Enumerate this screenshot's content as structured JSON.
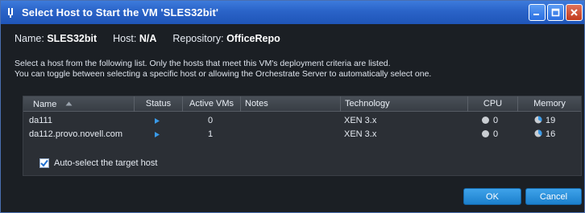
{
  "window": {
    "title": "Select Host to Start the VM 'SLES32bit'",
    "controls": [
      "minimize-icon",
      "maximize-icon",
      "close-icon"
    ]
  },
  "header": {
    "name_label": "Name:",
    "name_value": "SLES32bit",
    "host_label": "Host:",
    "host_value": "N/A",
    "repo_label": "Repository:",
    "repo_value": "OfficeRepo"
  },
  "instructions": {
    "line1": "Select a host from the following list. Only the hosts that meet this VM's deployment criteria are listed.",
    "line2": "You can toggle between selecting a specific host or allowing the Orchestrate Server to automatically select one."
  },
  "table": {
    "columns": [
      "Name",
      "Status",
      "Active VMs",
      "Notes",
      "Technology",
      "CPU",
      "Memory"
    ],
    "sort_icon": "sort-ascending-icon",
    "rows": [
      {
        "name": "da111",
        "status_icon": "status-flag-icon",
        "active_vms": "0",
        "notes": "",
        "technology": "XEN 3.x",
        "cpu": "0",
        "memory": "19"
      },
      {
        "name": "da112.provo.novell.com",
        "status_icon": "status-flag-icon",
        "active_vms": "1",
        "notes": "",
        "technology": "XEN 3.x",
        "cpu": "0",
        "memory": "16"
      }
    ]
  },
  "auto_select": {
    "label": "Auto-select the target host",
    "checked": true
  },
  "buttons": {
    "ok": "OK",
    "cancel": "Cancel"
  },
  "colors": {
    "titlebar": "#2a63c8",
    "body_bg": "#1b1f24",
    "button": "#2a8fdc",
    "status_icon": "#3a9ae8"
  }
}
